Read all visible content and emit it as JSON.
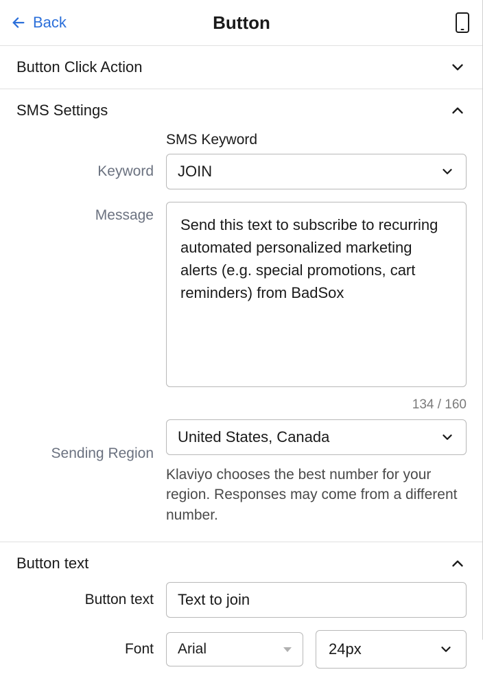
{
  "header": {
    "back_label": "Back",
    "title": "Button"
  },
  "sections": {
    "button_click_action": {
      "title": "Button Click Action",
      "expanded": false
    },
    "sms_settings": {
      "title": "SMS Settings",
      "expanded": true,
      "sublabel": "SMS Keyword",
      "keyword_label": "Keyword",
      "keyword_value": "JOIN",
      "message_label": "Message",
      "message_value": "Send this text to subscribe to recurring automated personalized marketing alerts (e.g. special promotions, cart reminders) from BadSox",
      "char_counter": "134 / 160",
      "region_label": "Sending Region",
      "region_value": "United States, Canada",
      "region_helper": "Klaviyo chooses the best number for your region. Responses may come from a different number."
    },
    "button_text": {
      "title": "Button text",
      "expanded": true,
      "text_label": "Button text",
      "text_value": "Text to join",
      "font_label": "Font",
      "font_value": "Arial",
      "font_size_value": "24px"
    }
  }
}
